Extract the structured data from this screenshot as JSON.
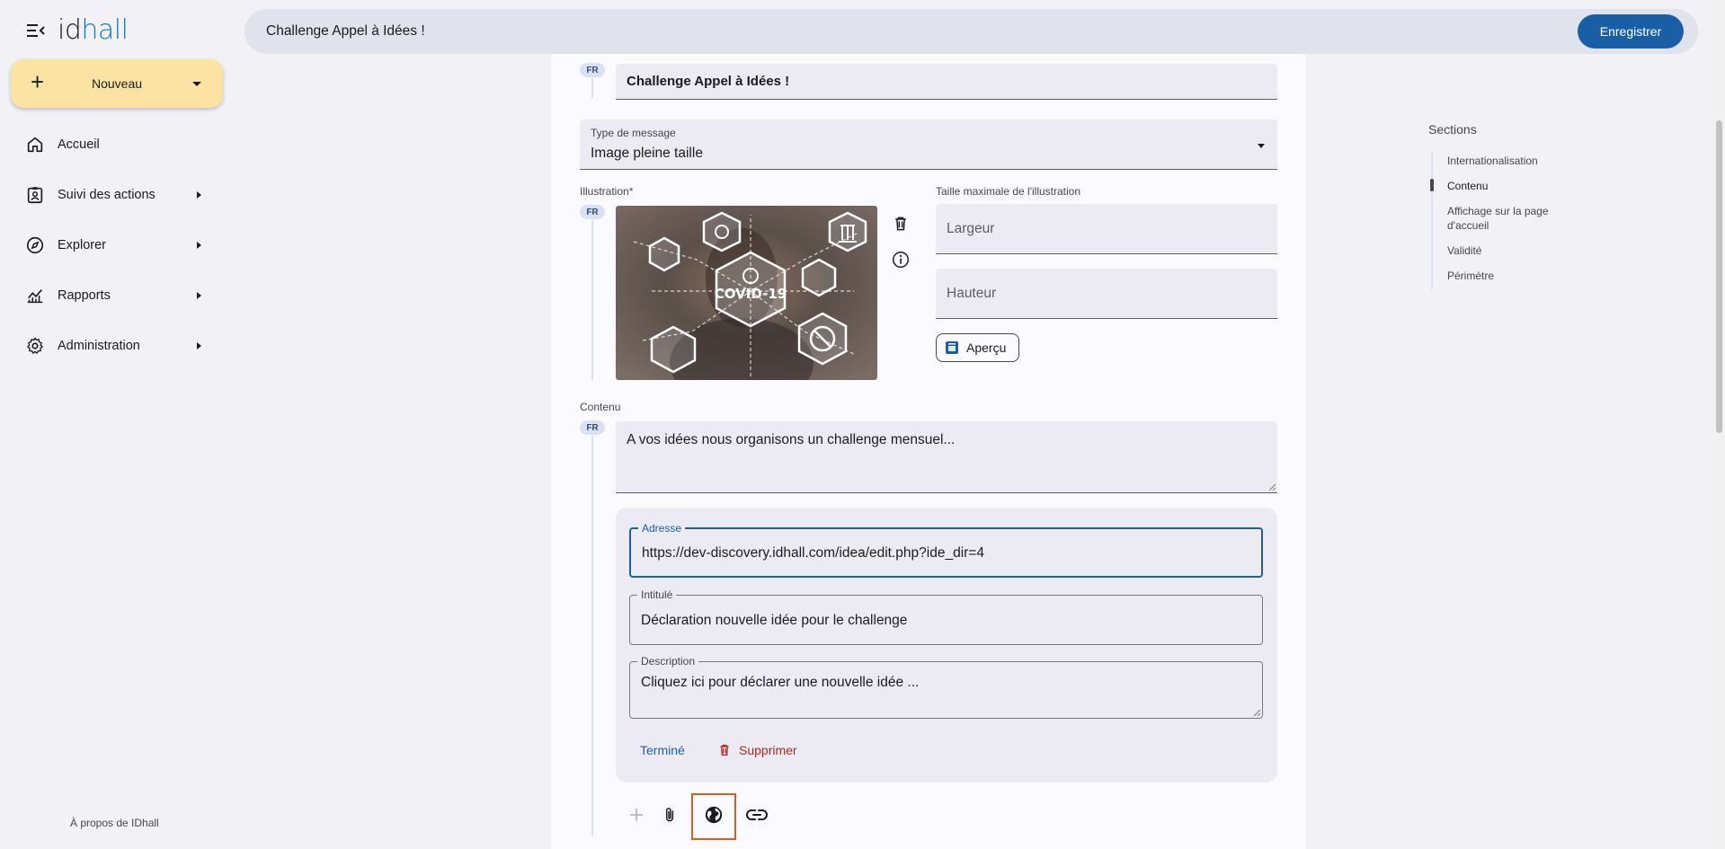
{
  "app": {
    "logo_text_a": "id",
    "logo_text_b": "hall",
    "new_button": "Nouveau",
    "about_link": "À propos de IDhall"
  },
  "nav": {
    "items": [
      {
        "label": "Accueil",
        "icon": "home-icon"
      },
      {
        "label": "Suivi des actions",
        "icon": "clipboard-user-icon"
      },
      {
        "label": "Explorer",
        "icon": "compass-icon"
      },
      {
        "label": "Rapports",
        "icon": "chart-icon"
      },
      {
        "label": "Administration",
        "icon": "gear-icon"
      }
    ]
  },
  "topbar": {
    "title": "Challenge Appel à Idées !",
    "save_label": "Enregistrer"
  },
  "form": {
    "lang": "FR",
    "title_value": "Challenge Appel à Idées !",
    "message_type_label": "Type de message",
    "message_type_value": "Image pleine taille",
    "illustration_label": "Illustration",
    "required_mark": "*",
    "illustration_text": "COVID-19",
    "max_size_label": "Taille maximale de l'illustration",
    "width_placeholder": "Largeur",
    "height_placeholder": "Hauteur",
    "preview_label": "Aperçu",
    "content_label": "Contenu",
    "content_value": "A vos idées nous organisons un challenge mensuel...",
    "link": {
      "address_label": "Adresse",
      "address_value": "https://dev-discovery.idhall.com/idea/edit.php?ide_dir=4",
      "title_label": "Intitulé",
      "title_value": "Déclaration nouvelle idée pour le challenge",
      "description_label": "Description",
      "description_value": "Cliquez ici pour déclarer une nouvelle idée ...",
      "done_label": "Terminé",
      "delete_label": "Supprimer"
    }
  },
  "sections": {
    "title": "Sections",
    "items": [
      "Internationalisation",
      "Contenu",
      "Affichage sur la page d'accueil",
      "Validité",
      "Périmètre"
    ],
    "active_index": 1
  },
  "colors": {
    "primary": "#1a5fa6",
    "accent_yellow": "#fbe3a3",
    "danger": "#b3261e",
    "highlight": "#e35b19"
  }
}
